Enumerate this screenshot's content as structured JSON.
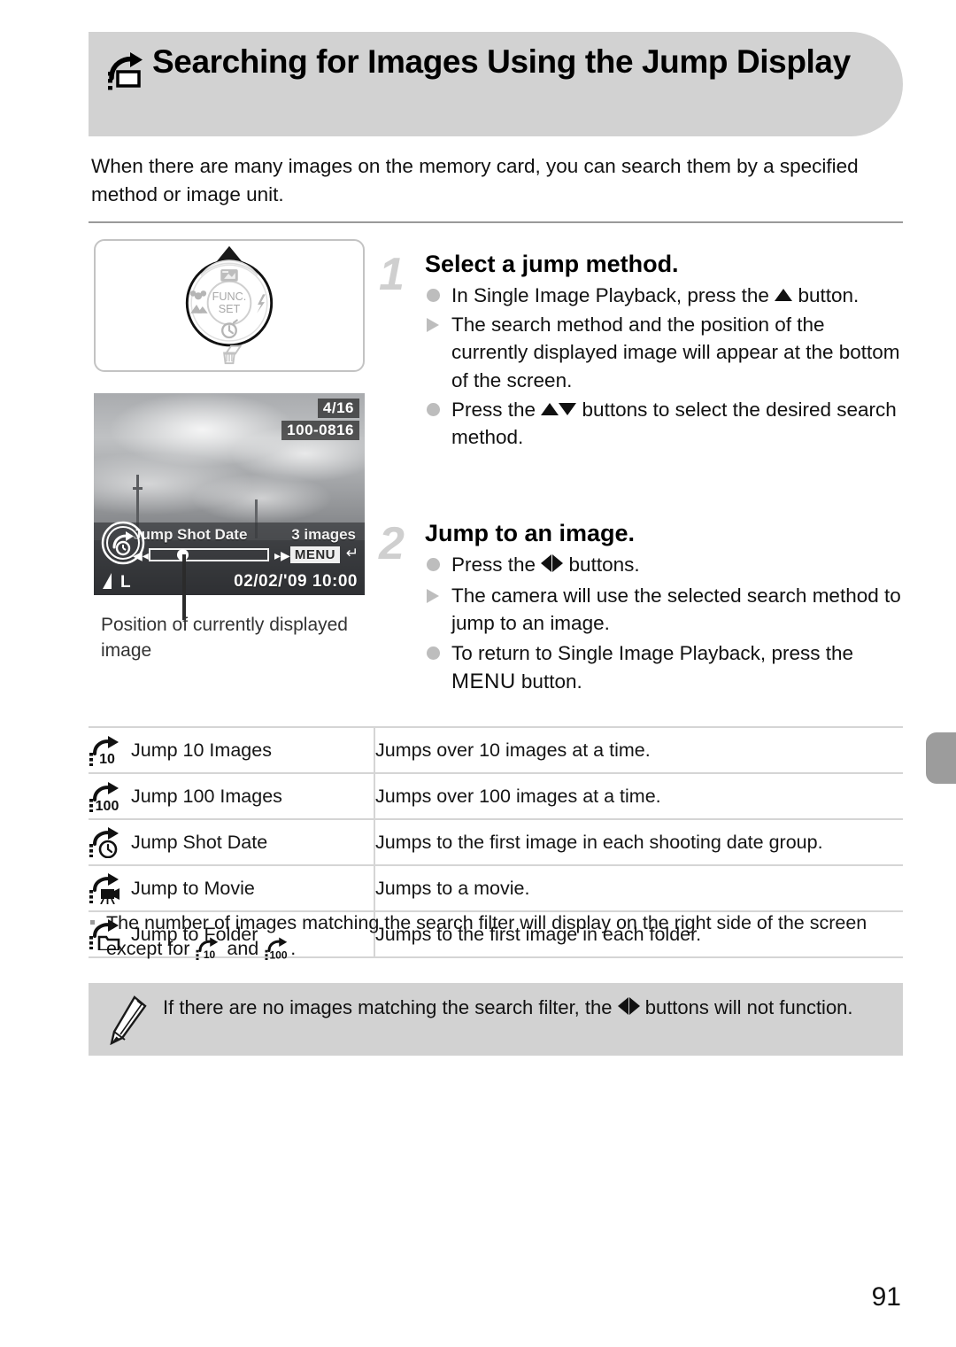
{
  "header": {
    "icon": "jump-display-icon",
    "title": "Searching for Images Using the Jump Display"
  },
  "intro": {
    "text": "When there are many images on the memory card, you can search them by a specified method or image unit."
  },
  "dial_illustration": {
    "center_label_line1": "FUNC.",
    "center_label_line2": "SET",
    "up_icon": "exposure-compensation-icon",
    "right_icon": "flash-icon",
    "down_icon": "self-timer-icon",
    "left_icon": "macro-icon",
    "below_icon": "trash-icon"
  },
  "lcd_screen": {
    "image_count": "4/16",
    "file_number": "100-0816",
    "jump_method": "Jump Shot Date",
    "matches": "3 images",
    "menu_label": "MENU",
    "return_icon": "return-arrow-icon",
    "quality_label": "L",
    "quality_icon": "fine-quality-icon",
    "datetime": "02/02/'09 10:00",
    "left_arrow_icon": "prev-arrow-icon",
    "right_arrow_icon": "next-arrow-icon",
    "jump_badge_icon": "jump-shot-date-icon"
  },
  "caption": {
    "text": "Position of currently displayed image"
  },
  "steps": [
    {
      "number": "1",
      "heading": "Select a jump method.",
      "bullets": [
        {
          "marker": "dot",
          "parts": [
            {
              "type": "text",
              "value": "In Single Image Playback, press the "
            },
            {
              "type": "icon",
              "value": "up-arrow-icon"
            },
            {
              "type": "text",
              "value": " button."
            }
          ]
        },
        {
          "marker": "triangle",
          "parts": [
            {
              "type": "text",
              "value": "The search method and the position of the currently displayed image will appear at the bottom of the screen."
            }
          ]
        },
        {
          "marker": "dot",
          "parts": [
            {
              "type": "text",
              "value": "Press the "
            },
            {
              "type": "icon",
              "value": "up-arrow-icon"
            },
            {
              "type": "icon",
              "value": "down-arrow-icon"
            },
            {
              "type": "text",
              "value": " buttons to select the desired search method."
            }
          ]
        }
      ]
    },
    {
      "number": "2",
      "heading": "Jump to an image.",
      "bullets": [
        {
          "marker": "dot",
          "parts": [
            {
              "type": "text",
              "value": "Press the "
            },
            {
              "type": "icon",
              "value": "left-right-arrows-icon"
            },
            {
              "type": "text",
              "value": " buttons."
            }
          ]
        },
        {
          "marker": "triangle",
          "parts": [
            {
              "type": "text",
              "value": "The camera will use the selected search method to jump to an image."
            }
          ]
        },
        {
          "marker": "dot",
          "parts": [
            {
              "type": "text",
              "value": "To return to Single Image Playback, press the "
            },
            {
              "type": "menu",
              "value": "MENU"
            },
            {
              "type": "text",
              "value": " button."
            }
          ]
        }
      ]
    }
  ],
  "table": {
    "rows": [
      {
        "icon": "jump-10-images-icon",
        "icon_label": "10",
        "name": "Jump 10 Images",
        "description": "Jumps over 10 images at a time."
      },
      {
        "icon": "jump-100-images-icon",
        "icon_label": "100",
        "name": "Jump 100 Images",
        "description": "Jumps over 100 images at a time."
      },
      {
        "icon": "jump-shot-date-icon",
        "icon_label": "",
        "name": "Jump Shot Date",
        "description": "Jumps to the first image in each shooting date group."
      },
      {
        "icon": "jump-to-movie-icon",
        "icon_label": "",
        "name": "Jump to Movie",
        "description": "Jumps to a movie."
      },
      {
        "icon": "jump-to-folder-icon",
        "icon_label": "",
        "name": "Jump to Folder",
        "description": "Jumps to the first image in each folder."
      }
    ]
  },
  "footnote": {
    "part1": "The number of images matching the search filter will display on the right side of the screen except for ",
    "icon1": "jump-10-images-icon",
    "icon1_label": "10",
    "middle": " and ",
    "icon2": "jump-100-images-icon",
    "icon2_label": "100",
    "part2": "."
  },
  "note": {
    "icon": "pencil-icon",
    "part1": "If there are no images matching the search filter, the ",
    "icon_inline": "left-right-arrows-icon",
    "part2": " buttons will not function."
  },
  "page": {
    "number": "91",
    "margin_tab": "chapter-thumb-index"
  },
  "colors": {
    "header_band": "#d2d2d2",
    "note_band": "#d2d2d2",
    "step_number": "#cfcfcf",
    "bullet_marker": "#bdbdbd",
    "rule": "#9a9a9a",
    "table_border": "#d5d5d5",
    "margin_tab": "#9c9c9c"
  }
}
